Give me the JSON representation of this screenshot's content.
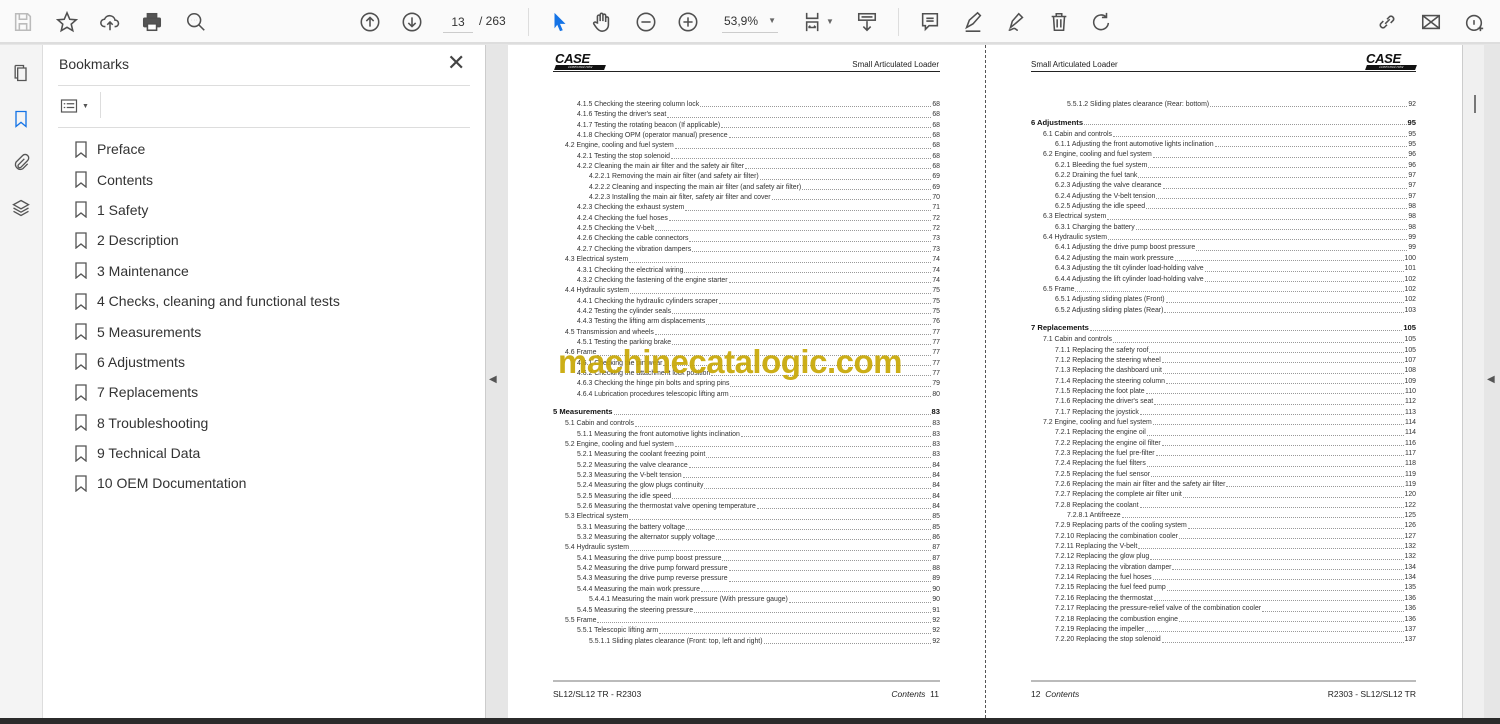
{
  "toolbar": {
    "page_current": "13",
    "page_total": "/ 263",
    "zoom": "53,9%",
    "accent": "#1473e6"
  },
  "bookmarks": {
    "title": "Bookmarks",
    "close": "✕",
    "items": [
      "Preface",
      "Contents",
      "1 Safety",
      "2 Description",
      "3 Maintenance",
      "4 Checks, cleaning and functional tests",
      "5 Measurements",
      "6 Adjustments",
      "7 Replacements",
      "8 Troubleshooting",
      "9 Technical Data",
      "10 OEM Documentation"
    ]
  },
  "watermark": "machinecatalogic.com",
  "pages": [
    {
      "logo": "CASE",
      "logo_sub": "CONSTRUCTION",
      "header": "Small Articulated Loader",
      "footer_left": "SL12/SL12 TR -  R2303",
      "footer_label": "Contents",
      "footer_page": "11",
      "toc": [
        {
          "t": "4.1.5 Checking the steering column lock",
          "p": "68",
          "l": 2
        },
        {
          "t": "4.1.6 Testing the driver's seat",
          "p": "68",
          "l": 2
        },
        {
          "t": "4.1.7 Testing the rotating beacon (If applicable)",
          "p": "68",
          "l": 2
        },
        {
          "t": "4.1.8 Checking OPM (operator manual) presence",
          "p": "68",
          "l": 2
        },
        {
          "t": "4.2 Engine, cooling and fuel system",
          "p": "68",
          "l": 1
        },
        {
          "t": "4.2.1 Testing the stop solenoid",
          "p": "68",
          "l": 2
        },
        {
          "t": "4.2.2 Cleaning the main air filter and the safety air filter",
          "p": "68",
          "l": 2
        },
        {
          "t": "4.2.2.1 Removing the main air filter (and safety air filter)",
          "p": "69",
          "l": 3
        },
        {
          "t": "4.2.2.2 Cleaning and inspecting the main air filter (and safety air filter)",
          "p": "69",
          "l": 3
        },
        {
          "t": "4.2.2.3 Installing the main air filter, safety air filter and cover",
          "p": "70",
          "l": 3
        },
        {
          "t": "4.2.3 Checking the exhaust system",
          "p": "71",
          "l": 2
        },
        {
          "t": "4.2.4 Checking the fuel hoses",
          "p": "72",
          "l": 2
        },
        {
          "t": "4.2.5 Checking the V-belt",
          "p": "72",
          "l": 2
        },
        {
          "t": "4.2.6 Checking the cable connectors",
          "p": "73",
          "l": 2
        },
        {
          "t": "4.2.7 Checking the vibration dampers",
          "p": "73",
          "l": 2
        },
        {
          "t": "4.3 Electrical system",
          "p": "74",
          "l": 1
        },
        {
          "t": "4.3.1 Checking the electrical wiring",
          "p": "74",
          "l": 2
        },
        {
          "t": "4.3.2 Checking the fastening of the engine starter",
          "p": "74",
          "l": 2
        },
        {
          "t": "4.4 Hydraulic system",
          "p": "75",
          "l": 1
        },
        {
          "t": "4.4.1 Checking the hydraulic cylinders scraper",
          "p": "75",
          "l": 2
        },
        {
          "t": "4.4.2 Testing the cylinder seals",
          "p": "75",
          "l": 2
        },
        {
          "t": "4.4.3 Testing the lifting arm displacements",
          "p": "76",
          "l": 2
        },
        {
          "t": "4.5 Transmission and wheels",
          "p": "77",
          "l": 1
        },
        {
          "t": "4.5.1 Testing the parking brake",
          "p": "77",
          "l": 2
        },
        {
          "t": "4.6 Frame",
          "p": "77",
          "l": 1
        },
        {
          "t": "4.6.1 Checking the pin wear",
          "p": "77",
          "l": 2
        },
        {
          "t": "4.6.2 Checking the attachment lock position",
          "p": "77",
          "l": 2
        },
        {
          "t": "4.6.3 Checking the hinge pin bolts and spring pins",
          "p": "79",
          "l": 2
        },
        {
          "t": "4.6.4 Lubrication procedures telescopic lifting arm",
          "p": "80",
          "l": 2
        },
        {
          "t": "5 Measurements",
          "p": "83",
          "l": 0
        },
        {
          "t": "5.1 Cabin and controls",
          "p": "83",
          "l": 1
        },
        {
          "t": "5.1.1 Measuring the front automotive lights inclination",
          "p": "83",
          "l": 2
        },
        {
          "t": "5.2 Engine, cooling and fuel system",
          "p": "83",
          "l": 1
        },
        {
          "t": "5.2.1 Measuring the coolant freezing point",
          "p": "83",
          "l": 2
        },
        {
          "t": "5.2.2 Measuring the valve clearance",
          "p": "84",
          "l": 2
        },
        {
          "t": "5.2.3 Measuring the V-belt tension",
          "p": "84",
          "l": 2
        },
        {
          "t": "5.2.4 Measuring the glow plugs continuity",
          "p": "84",
          "l": 2
        },
        {
          "t": "5.2.5 Measuring the idle speed",
          "p": "84",
          "l": 2
        },
        {
          "t": "5.2.6 Measuring the thermostat valve opening temperature",
          "p": "84",
          "l": 2
        },
        {
          "t": "5.3 Electrical system",
          "p": "85",
          "l": 1
        },
        {
          "t": "5.3.1 Measuring the battery voltage",
          "p": "85",
          "l": 2
        },
        {
          "t": "5.3.2 Measuring the alternator supply voltage",
          "p": "86",
          "l": 2
        },
        {
          "t": "5.4 Hydraulic system",
          "p": "87",
          "l": 1
        },
        {
          "t": "5.4.1 Measuring the drive pump boost pressure",
          "p": "87",
          "l": 2
        },
        {
          "t": "5.4.2 Measuring the drive pump forward pressure",
          "p": "88",
          "l": 2
        },
        {
          "t": "5.4.3 Measuring the drive pump reverse pressure",
          "p": "89",
          "l": 2
        },
        {
          "t": "5.4.4 Measuring the main work pressure",
          "p": "90",
          "l": 2
        },
        {
          "t": "5.4.4.1 Measuring the main work pressure (With pressure gauge)",
          "p": "90",
          "l": 3
        },
        {
          "t": "5.4.5 Measuring the steering pressure",
          "p": "91",
          "l": 2
        },
        {
          "t": "5.5 Frame",
          "p": "92",
          "l": 1
        },
        {
          "t": "5.5.1 Telescopic lifting arm",
          "p": "92",
          "l": 2
        },
        {
          "t": "5.5.1.1 Sliding plates clearance (Front: top, left and right)",
          "p": "92",
          "l": 3
        }
      ]
    },
    {
      "logo": "CASE",
      "logo_sub": "CONSTRUCTION",
      "header": "Small Articulated Loader",
      "footer_left": "12",
      "footer_label": "Contents",
      "footer_page": "R2303  - SL12/SL12 TR",
      "toc": [
        {
          "t": "5.5.1.2 Sliding plates clearance (Rear: bottom)",
          "p": "92",
          "l": 3
        },
        {
          "t": "6 Adjustments",
          "p": "95",
          "l": 0
        },
        {
          "t": "6.1 Cabin and controls",
          "p": "95",
          "l": 1
        },
        {
          "t": "6.1.1 Adjusting the front automotive lights inclination",
          "p": "95",
          "l": 2
        },
        {
          "t": "6.2 Engine, cooling and fuel system",
          "p": "96",
          "l": 1
        },
        {
          "t": "6.2.1 Bleeding the fuel system",
          "p": "96",
          "l": 2
        },
        {
          "t": "6.2.2 Draining the fuel tank",
          "p": "97",
          "l": 2
        },
        {
          "t": "6.2.3 Adjusting the valve clearance",
          "p": "97",
          "l": 2
        },
        {
          "t": "6.2.4 Adjusting the V-belt tension",
          "p": "97",
          "l": 2
        },
        {
          "t": "6.2.5 Adjusting the idle speed",
          "p": "98",
          "l": 2
        },
        {
          "t": "6.3 Electrical system",
          "p": "98",
          "l": 1
        },
        {
          "t": "6.3.1 Charging the battery",
          "p": "98",
          "l": 2
        },
        {
          "t": "6.4 Hydraulic system",
          "p": "99",
          "l": 1
        },
        {
          "t": "6.4.1 Adjusting the drive pump boost pressure",
          "p": "99",
          "l": 2
        },
        {
          "t": "6.4.2 Adjusting the main work pressure",
          "p": "100",
          "l": 2
        },
        {
          "t": "6.4.3 Adjusting the tilt cylinder load-holding valve",
          "p": "101",
          "l": 2
        },
        {
          "t": "6.4.4 Adjusting the lift cylinder load-holding valve",
          "p": "102",
          "l": 2
        },
        {
          "t": "6.5 Frame",
          "p": "102",
          "l": 1
        },
        {
          "t": "6.5.1 Adjusting sliding plates (Front)",
          "p": "102",
          "l": 2
        },
        {
          "t": "6.5.2 Adjusting sliding plates (Rear)",
          "p": "103",
          "l": 2
        },
        {
          "t": "7 Replacements",
          "p": "105",
          "l": 0
        },
        {
          "t": "7.1 Cabin and controls",
          "p": "105",
          "l": 1
        },
        {
          "t": "7.1.1 Replacing the safety roof",
          "p": "105",
          "l": 2
        },
        {
          "t": "7.1.2 Replacing the steering wheel",
          "p": "107",
          "l": 2
        },
        {
          "t": "7.1.3 Replacing the dashboard unit",
          "p": "108",
          "l": 2
        },
        {
          "t": "7.1.4 Replacing the steering column",
          "p": "109",
          "l": 2
        },
        {
          "t": "7.1.5 Replacing the foot plate",
          "p": "110",
          "l": 2
        },
        {
          "t": "7.1.6 Replacing the driver's seat",
          "p": "112",
          "l": 2
        },
        {
          "t": "7.1.7 Replacing the joystick",
          "p": "113",
          "l": 2
        },
        {
          "t": "7.2 Engine, cooling and fuel system",
          "p": "114",
          "l": 1
        },
        {
          "t": "7.2.1 Replacing the engine oil",
          "p": "114",
          "l": 2
        },
        {
          "t": "7.2.2 Replacing the engine oil filter",
          "p": "116",
          "l": 2
        },
        {
          "t": "7.2.3 Replacing the fuel pre-filter",
          "p": "117",
          "l": 2
        },
        {
          "t": "7.2.4 Replacing the fuel filters",
          "p": "118",
          "l": 2
        },
        {
          "t": "7.2.5 Replacing the fuel sensor",
          "p": "119",
          "l": 2
        },
        {
          "t": "7.2.6 Replacing the main air filter and the safety air filter",
          "p": "119",
          "l": 2
        },
        {
          "t": "7.2.7 Replacing the complete air filter unit",
          "p": "120",
          "l": 2
        },
        {
          "t": "7.2.8 Replacing the coolant",
          "p": "122",
          "l": 2
        },
        {
          "t": "7.2.8.1 Antifreeze",
          "p": "125",
          "l": 3
        },
        {
          "t": "7.2.9 Replacing parts of the cooling system",
          "p": "126",
          "l": 2
        },
        {
          "t": "7.2.10 Replacing the combination cooler",
          "p": "127",
          "l": 2
        },
        {
          "t": "7.2.11 Replacing the V-belt",
          "p": "132",
          "l": 2
        },
        {
          "t": "7.2.12 Replacing the glow plug",
          "p": "132",
          "l": 2
        },
        {
          "t": "7.2.13 Replacing the vibration damper",
          "p": "134",
          "l": 2
        },
        {
          "t": "7.2.14 Replacing the fuel hoses",
          "p": "134",
          "l": 2
        },
        {
          "t": "7.2.15 Replacing the fuel feed pump",
          "p": "135",
          "l": 2
        },
        {
          "t": "7.2.16 Replacing the thermostat",
          "p": "136",
          "l": 2
        },
        {
          "t": "7.2.17 Replacing the pressure-relief valve of the combination cooler",
          "p": "136",
          "l": 2
        },
        {
          "t": "7.2.18 Replacing the combustion engine",
          "p": "136",
          "l": 2
        },
        {
          "t": "7.2.19 Replacing the impeller",
          "p": "137",
          "l": 2
        },
        {
          "t": "7.2.20 Replacing the stop solenoid",
          "p": "137",
          "l": 2
        }
      ]
    }
  ]
}
